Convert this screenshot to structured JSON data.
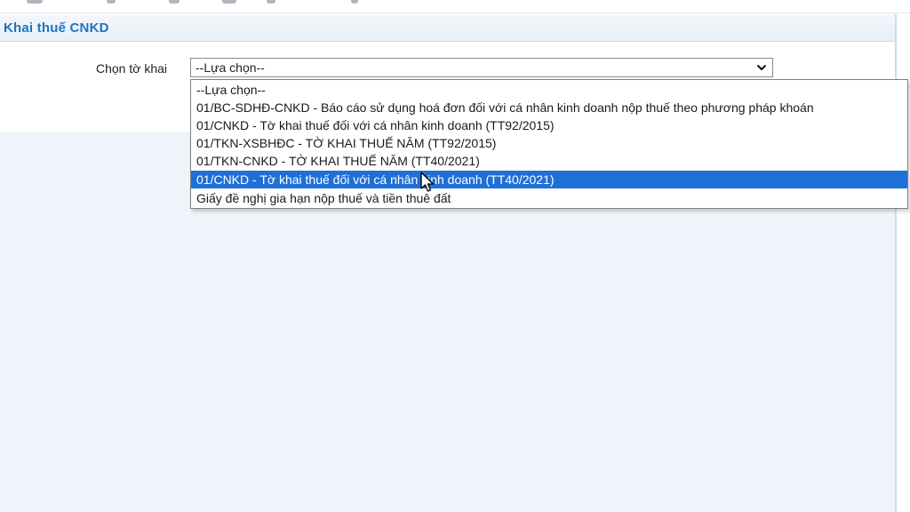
{
  "panel": {
    "title": "Khai thuế CNKD"
  },
  "form": {
    "label": "Chọn tờ khai",
    "select_value": "--Lựa chọn--"
  },
  "dropdown": {
    "options": [
      {
        "label": "--Lựa chọn--",
        "selected": false
      },
      {
        "label": "01/BC-SDHĐ-CNKD - Báo cáo sử dụng hoá đơn đối với cá nhân kinh doanh nộp thuế theo phương pháp khoán",
        "selected": false
      },
      {
        "label": "01/CNKD - Tờ khai thuế đối với cá nhân kinh doanh (TT92/2015)",
        "selected": false
      },
      {
        "label": "01/TKN-XSBHĐC - TỜ KHAI THUẾ NĂM (TT92/2015)",
        "selected": false
      },
      {
        "label": "01/TKN-CNKD - TỜ KHAI THUẾ NĂM (TT40/2021)",
        "selected": false
      },
      {
        "label": "01/CNKD - Tờ khai thuế đối với cá nhân kinh doanh (TT40/2021)",
        "selected": true
      },
      {
        "label": "Giấy đề nghị gia hạn nộp thuế và tiền thuê đất",
        "selected": false
      }
    ]
  },
  "colors": {
    "title": "#1f74bf",
    "selection": "#1e70d6"
  },
  "icons": {
    "chevron": "chevron-down-icon",
    "cursor": "mouse-pointer-icon"
  }
}
